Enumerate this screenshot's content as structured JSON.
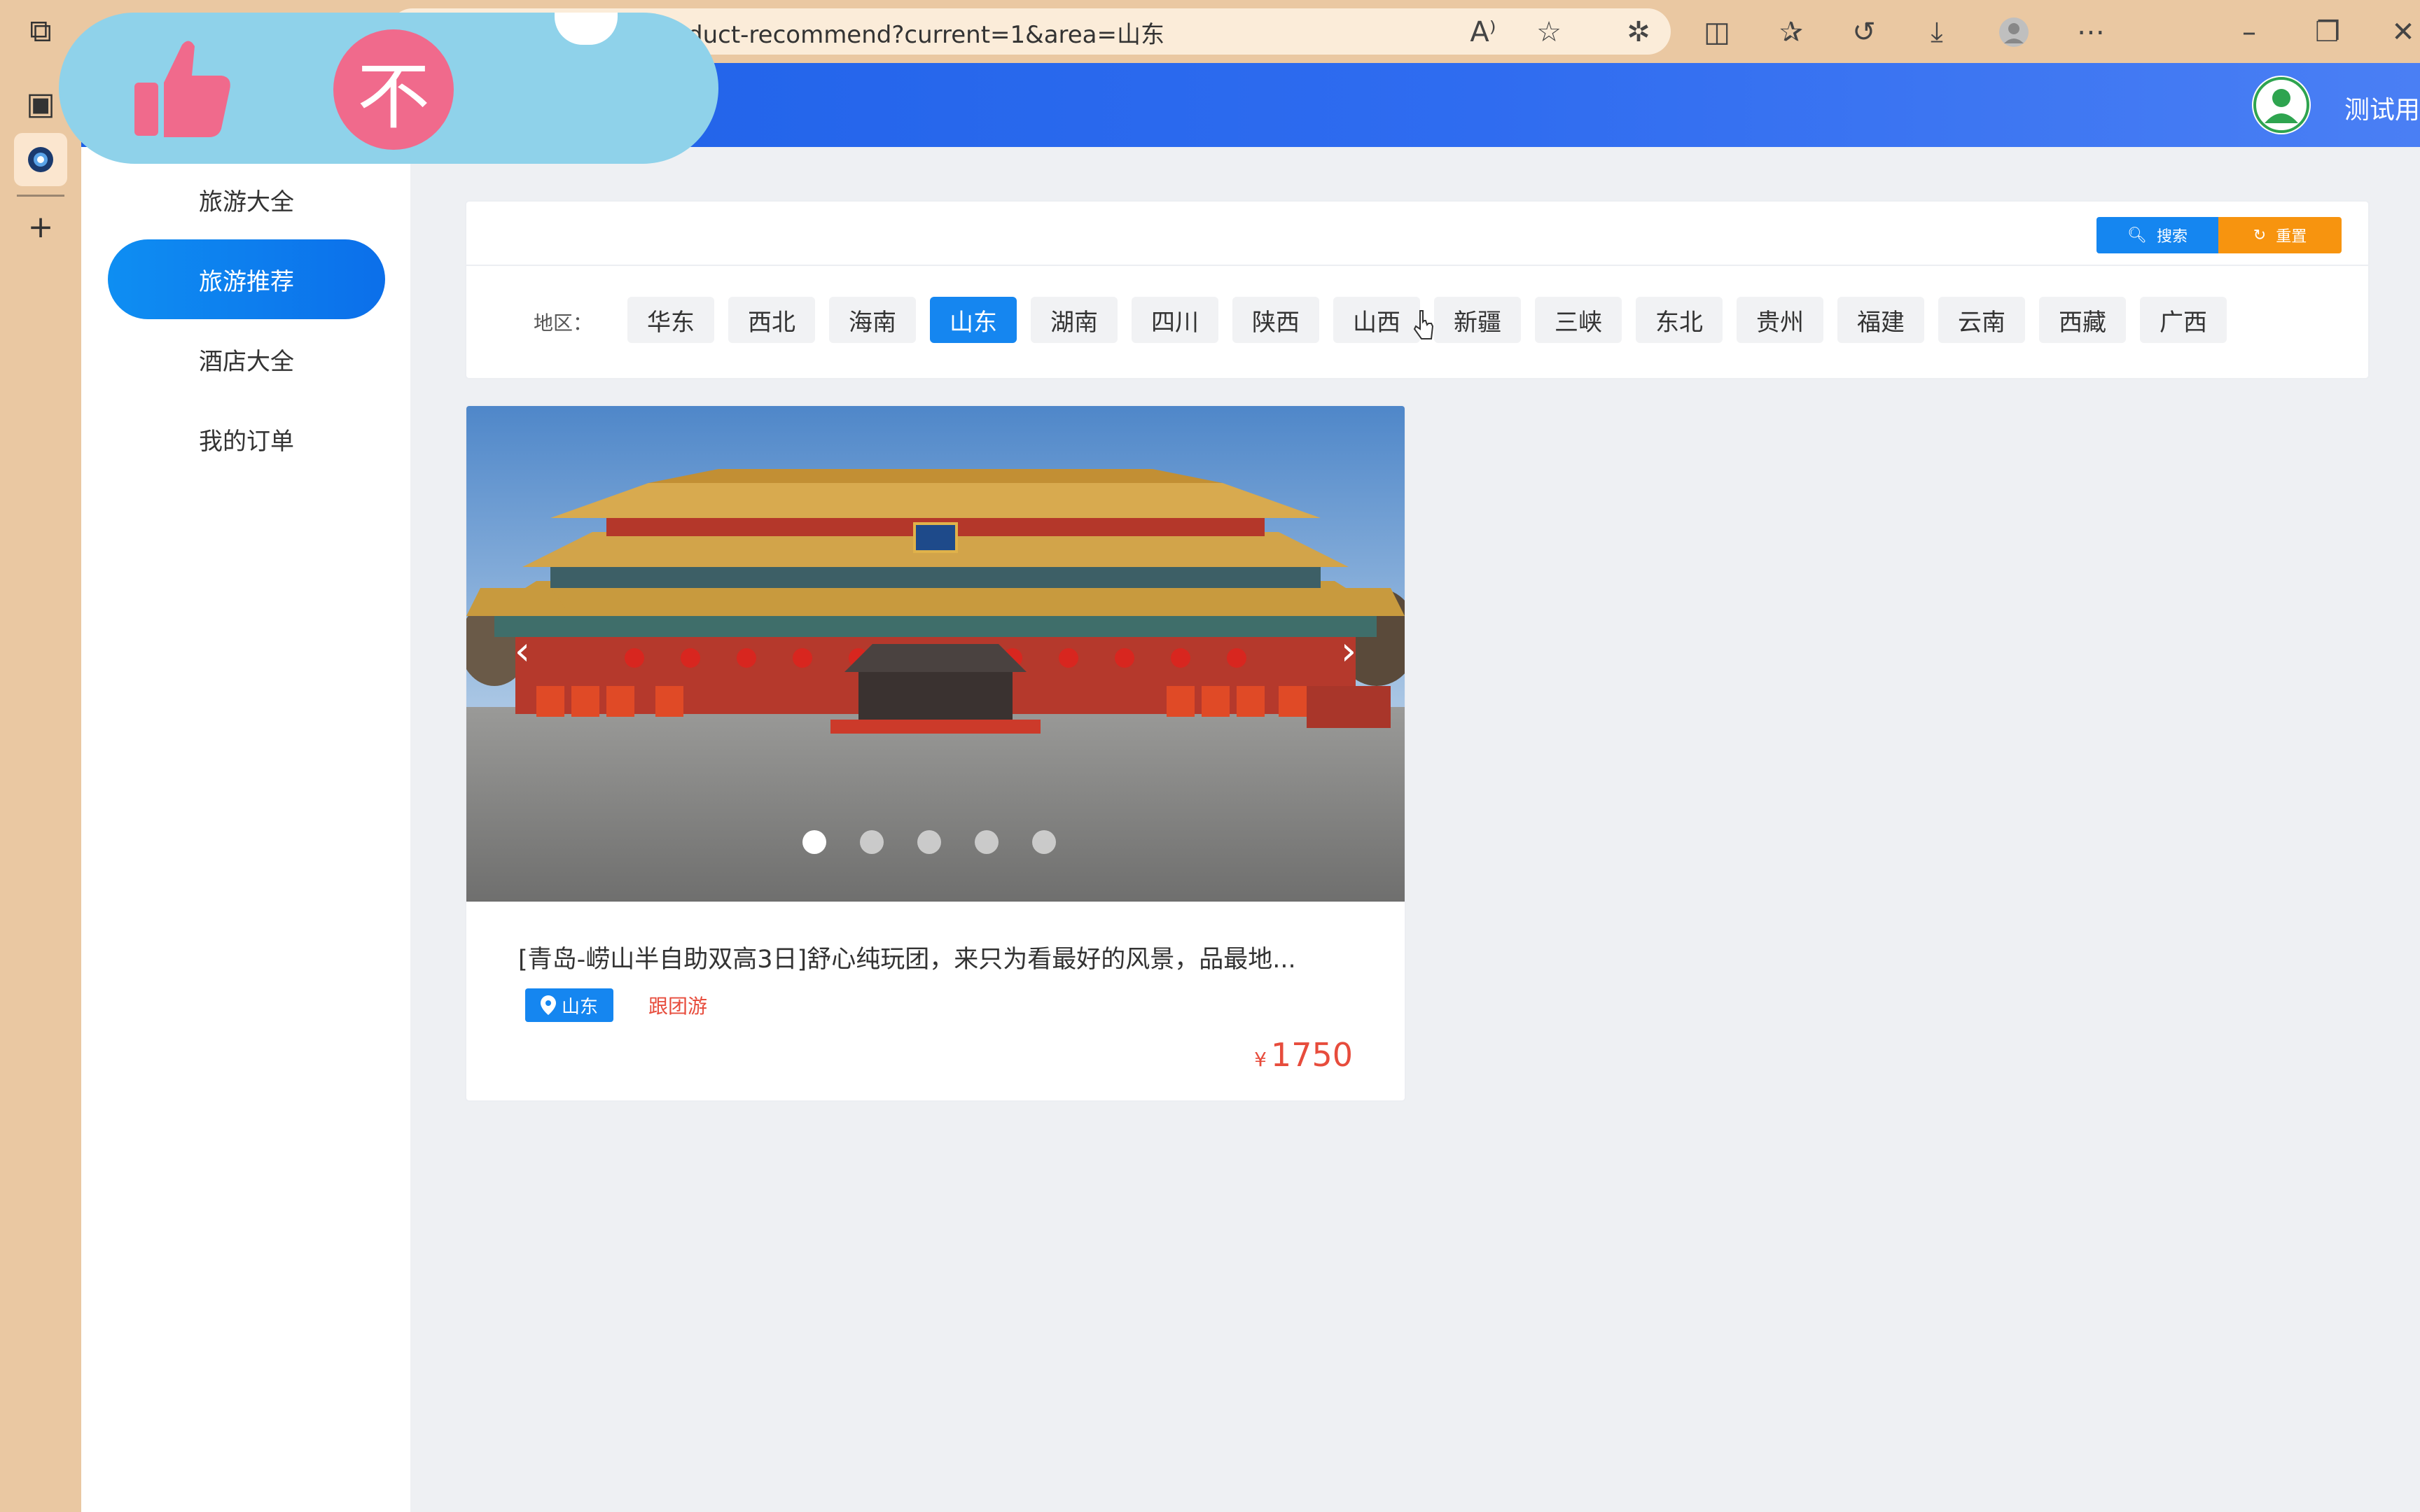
{
  "browser": {
    "url": "duct-recommend?current=1&area=山东",
    "icons": [
      "workspaces-icon",
      "tab-actions-icon",
      "browser-icon",
      "new-tab-icon",
      "read-aloud-icon",
      "favorite-icon",
      "extensions-icon",
      "split-screen-icon",
      "favorites-icon",
      "history-icon",
      "downloads-icon",
      "profile-icon",
      "more-icon",
      "minimize-icon",
      "restore-icon",
      "close-icon"
    ]
  },
  "overlay": {
    "circle_glyph": "不"
  },
  "header": {
    "username": "测试用户"
  },
  "sidebar": {
    "items": [
      {
        "label": "旅游大全"
      },
      {
        "label": "旅游推荐"
      },
      {
        "label": "酒店大全"
      },
      {
        "label": "我的订单"
      }
    ],
    "active_index": 1
  },
  "filter": {
    "search_label": "搜索",
    "reset_label": "重置",
    "area_label": "地区：",
    "areas": [
      "华东",
      "西北",
      "海南",
      "山东",
      "湖南",
      "四川",
      "陕西",
      "山西",
      "新疆",
      "三峡",
      "东北",
      "贵州",
      "福建",
      "云南",
      "西藏",
      "广西"
    ],
    "selected": "山东"
  },
  "product": {
    "title": "[青岛-崂山半自助双高3日]舒心纯玩团，来只为看最好的风景，品最地...",
    "area_tag": "山东",
    "type_tag": "跟团游",
    "currency": "¥",
    "price": "1750",
    "carousel_count": 5,
    "carousel_active": 0
  },
  "colors": {
    "primary": "#1586f0",
    "header": "#2f6cf0",
    "accent_orange": "#f7940f",
    "price_red": "#e74c3c",
    "overlay_bg": "#8fd2ea",
    "overlay_pink": "#f06a8c",
    "browser_chrome": "#eac8a2"
  }
}
